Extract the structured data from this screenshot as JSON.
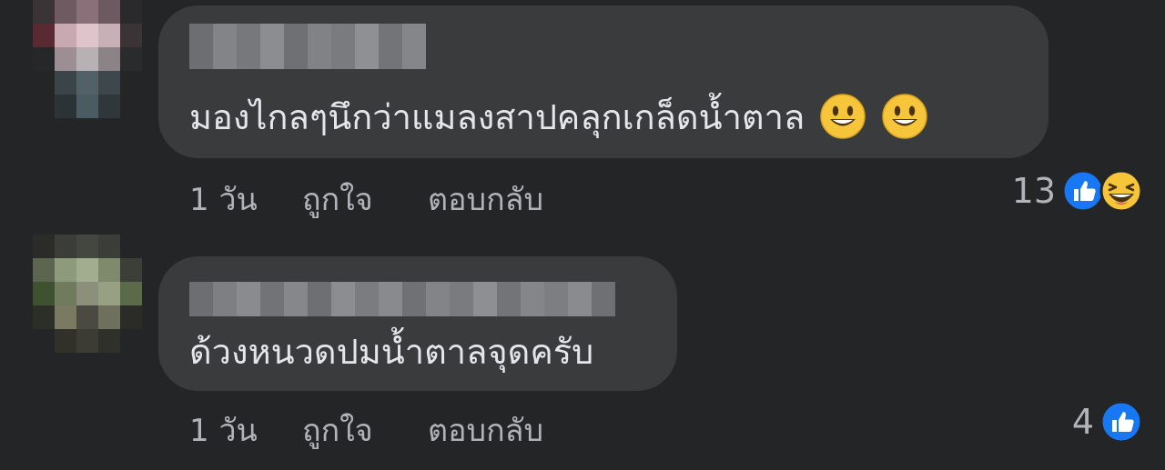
{
  "comments": [
    {
      "text": "มองไกลๆนึกว่าแมลงสาปคลุกเกล็ดน้ำตาล",
      "emojis": [
        "smiley-emoji",
        "smiley-emoji"
      ],
      "time": "1 วัน",
      "like_label": "ถูกใจ",
      "reply_label": "ตอบกลับ",
      "reaction_count": "13",
      "reactions": [
        "like-icon",
        "haha-icon"
      ]
    },
    {
      "text": "ด้วงหนวดปมน้ำตาลจุดครับ",
      "emojis": [],
      "time": "1 วัน",
      "like_label": "ถูกใจ",
      "reply_label": "ตอบกลับ",
      "reaction_count": "4",
      "reactions": [
        "like-icon"
      ]
    }
  ],
  "colors": {
    "background": "#242526",
    "bubble": "#3a3b3c",
    "text": "#e4e6eb",
    "secondary_text": "#b0b3b8",
    "like_blue": "#1877f2",
    "emoji_yellow": "#f7c53a"
  }
}
